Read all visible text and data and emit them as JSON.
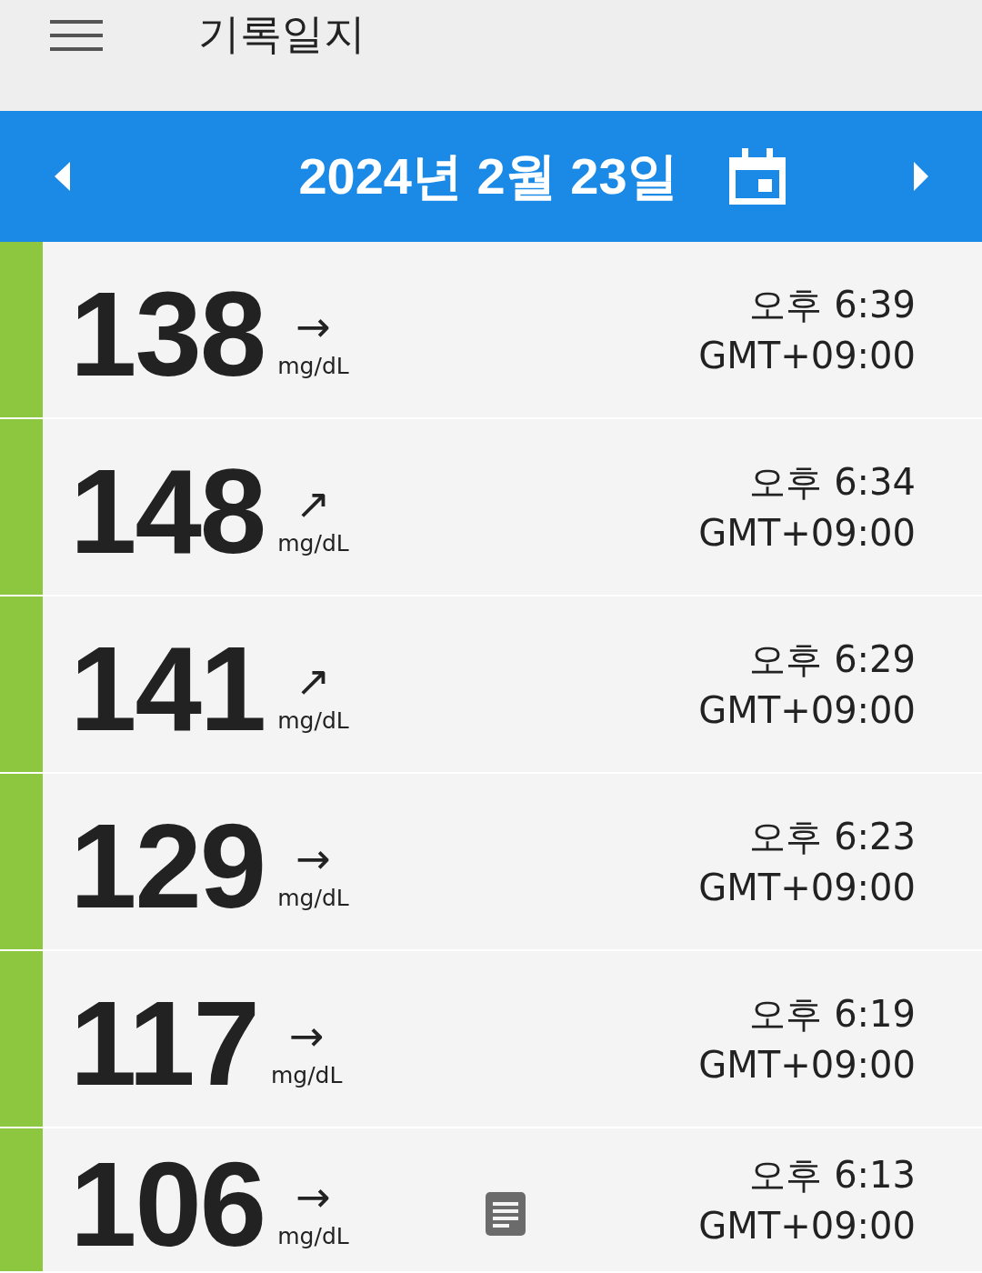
{
  "header": {
    "title": "기록일지"
  },
  "date_bar": {
    "date": "2024년 2월 23일"
  },
  "readings": [
    {
      "value": "138",
      "trend": "→",
      "unit": "mg/dL",
      "time": "오후 6:39",
      "timezone": "GMT+09:00",
      "note": false,
      "color": "#8dc63f"
    },
    {
      "value": "148",
      "trend": "↗",
      "unit": "mg/dL",
      "time": "오후 6:34",
      "timezone": "GMT+09:00",
      "note": false,
      "color": "#8dc63f"
    },
    {
      "value": "141",
      "trend": "↗",
      "unit": "mg/dL",
      "time": "오후 6:29",
      "timezone": "GMT+09:00",
      "note": false,
      "color": "#8dc63f"
    },
    {
      "value": "129",
      "trend": "→",
      "unit": "mg/dL",
      "time": "오후 6:23",
      "timezone": "GMT+09:00",
      "note": false,
      "color": "#8dc63f"
    },
    {
      "value": "117",
      "trend": "→",
      "unit": "mg/dL",
      "time": "오후 6:19",
      "timezone": "GMT+09:00",
      "note": false,
      "color": "#8dc63f"
    },
    {
      "value": "106",
      "trend": "→",
      "unit": "mg/dL",
      "time": "오후 6:13",
      "timezone": "GMT+09:00",
      "note": true,
      "color": "#8dc63f"
    }
  ]
}
